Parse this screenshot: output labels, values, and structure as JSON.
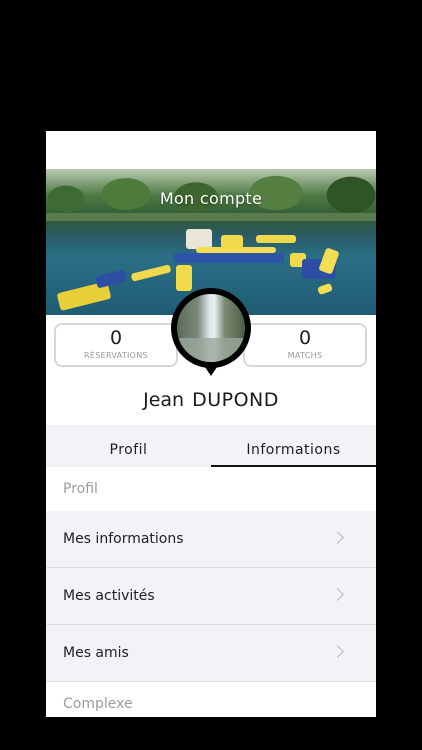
{
  "header": {
    "title": "Mon compte"
  },
  "stats": {
    "reservations": {
      "value": "0",
      "label": "RÉSERVATIONS"
    },
    "matchs": {
      "value": "0",
      "label": "MATCHS"
    }
  },
  "user": {
    "first_name": "Jean",
    "last_name": "DUPOND"
  },
  "tabs": [
    {
      "label": "Profil",
      "active": false
    },
    {
      "label": "Informations",
      "active": true
    }
  ],
  "sections": {
    "profil": "Profil",
    "complexe": "Complexe"
  },
  "menu": [
    {
      "label": "Mes informations",
      "icon": "chevron-right-icon"
    },
    {
      "label": "Mes activités",
      "icon": "chevron-right-icon"
    },
    {
      "label": "Mes amis",
      "icon": "chevron-right-icon"
    }
  ]
}
